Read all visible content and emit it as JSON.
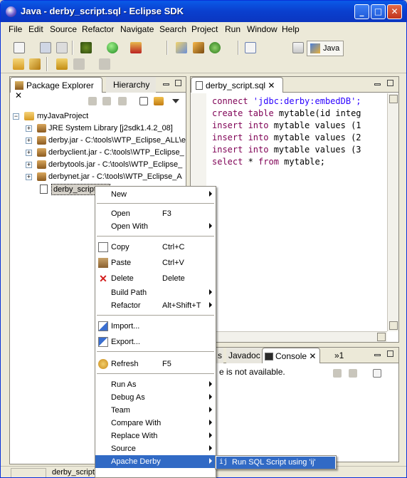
{
  "window": {
    "title": "Java - derby_script.sql - Eclipse SDK",
    "min": "_",
    "max": "□",
    "close": "✕"
  },
  "menubar": [
    "File",
    "Edit",
    "Source",
    "Refactor",
    "Navigate",
    "Search",
    "Project",
    "Run",
    "Window",
    "Help"
  ],
  "perspective": {
    "label": "Java"
  },
  "package_explorer": {
    "tabs": [
      {
        "label": "Package Explorer",
        "close": "✕"
      },
      {
        "label": "Hierarchy"
      }
    ],
    "tree": [
      {
        "label": "myJavaProject",
        "expander": "−"
      },
      {
        "label": "JRE System Library [j2sdk1.4.2_08]",
        "expander": "+"
      },
      {
        "label": "derby.jar - C:\\tools\\WTP_Eclipse_ALL\\e",
        "expander": "+"
      },
      {
        "label": "derbyclient.jar - C:\\tools\\WTP_Eclipse_",
        "expander": "+"
      },
      {
        "label": "derbytools.jar - C:\\tools\\WTP_Eclipse_",
        "expander": "+"
      },
      {
        "label": "derbynet.jar - C:\\tools\\WTP_Eclipse_A",
        "expander": "+"
      },
      {
        "label": "derby_script.sql"
      }
    ]
  },
  "editor": {
    "tab": {
      "label": "derby_script.sql",
      "close": "✕"
    },
    "lines": [
      {
        "kw": "connect",
        "rest": " 'jdbc:derby:embedDB';"
      },
      {
        "kw": "create table",
        "rest": " mytable(id integ"
      },
      {
        "kw": "insert into",
        "rest": " mytable values (1"
      },
      {
        "kw": "insert into",
        "rest": " mytable values (2"
      },
      {
        "kw": "insert into",
        "rest": " mytable values (3"
      },
      {
        "kw": "select",
        "rest": " * ",
        "kw2": "from",
        "rest2": " mytable;"
      }
    ]
  },
  "console_panel": {
    "tabs": [
      {
        "label": "s"
      },
      {
        "label": "Javadoc"
      },
      {
        "label": "Console",
        "close": "✕"
      },
      {
        "label": "»1"
      }
    ],
    "message": "e is not available."
  },
  "context_menu": {
    "items": [
      {
        "label": "New",
        "submenu": true
      },
      {
        "sep": true
      },
      {
        "label": "Open",
        "key": "F3"
      },
      {
        "label": "Open With",
        "submenu": true
      },
      {
        "sep": true
      },
      {
        "label": "Copy",
        "key": "Ctrl+C",
        "icon": "copy-icon"
      },
      {
        "label": "Paste",
        "key": "Ctrl+V",
        "icon": "paste-icon"
      },
      {
        "label": "Delete",
        "key": "Delete",
        "icon": "delete-icon"
      },
      {
        "label": "Build Path",
        "submenu": true
      },
      {
        "label": "Refactor",
        "key": "Alt+Shift+T",
        "submenu": true
      },
      {
        "sep": true
      },
      {
        "label": "Import...",
        "icon": "import-icon"
      },
      {
        "label": "Export...",
        "icon": "export-icon"
      },
      {
        "sep": true
      },
      {
        "label": "Refresh",
        "key": "F5",
        "icon": "refresh-icon"
      },
      {
        "sep": true
      },
      {
        "label": "Run As",
        "submenu": true
      },
      {
        "label": "Debug As",
        "submenu": true
      },
      {
        "label": "Team",
        "submenu": true
      },
      {
        "label": "Compare With",
        "submenu": true
      },
      {
        "label": "Replace With",
        "submenu": true
      },
      {
        "label": "Source",
        "submenu": true
      },
      {
        "label": "Apache Derby",
        "submenu": true,
        "highlighted": true
      }
    ]
  },
  "submenu": {
    "icon": "ij",
    "label": "Run SQL Script using 'ij'"
  },
  "status": {
    "text": "derby_script"
  }
}
